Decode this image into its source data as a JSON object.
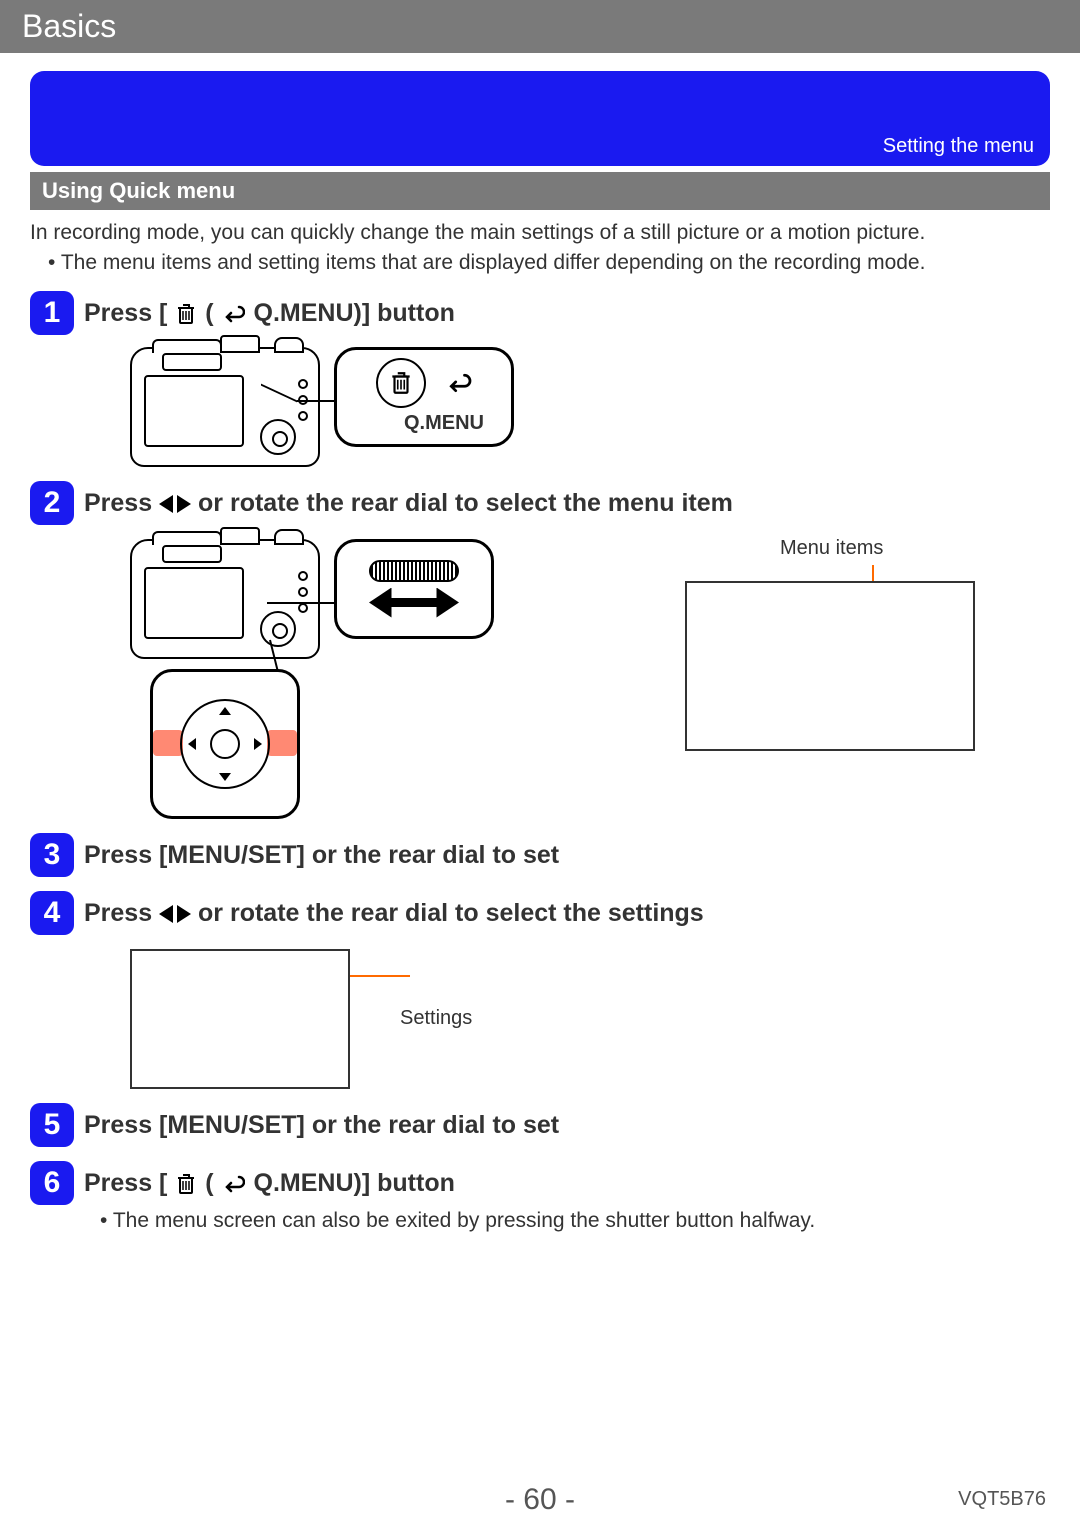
{
  "header": "Basics",
  "blue_label": "Setting the menu",
  "sub_bar": "Using Quick menu",
  "intro": "In recording mode, you can quickly change the main settings of a still picture or a motion picture.",
  "intro_bullet": "The menu items and setting items that are displayed differ depending on the recording mode.",
  "steps": {
    "s1_pre": "Press [",
    "s1_mid": " (",
    "s1_post": " Q.MENU)] button",
    "s2_pre": "Press ",
    "s2_post": " or rotate the rear dial to select the menu item",
    "s3": "Press [MENU/SET] or the rear dial to set",
    "s4_pre": "Press ",
    "s4_post": " or rotate the rear dial to select the settings",
    "s5": "Press [MENU/SET] or the rear dial to set",
    "s6_pre": "Press [",
    "s6_mid": " (",
    "s6_post": " Q.MENU)] button"
  },
  "callouts": {
    "qmenu": "Q.MENU",
    "menu_items": "Menu items",
    "settings": "Settings"
  },
  "note6": "The menu screen can also be exited by pressing the shutter button halfway.",
  "page_number": "- 60 -",
  "doc_code": "VQT5B76"
}
